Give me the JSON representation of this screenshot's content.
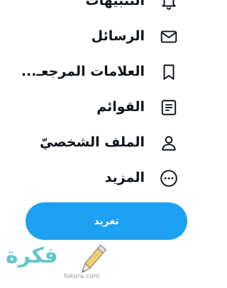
{
  "nav": {
    "items": [
      {
        "label": "التنبيهات",
        "icon": "bell-icon"
      },
      {
        "label": "الرسائل",
        "icon": "envelope-icon"
      },
      {
        "label": "العلامات المرجعـ...",
        "icon": "bookmark-icon"
      },
      {
        "label": "القوائم",
        "icon": "list-icon"
      },
      {
        "label": "الملف الشخصيّ",
        "icon": "person-icon"
      },
      {
        "label": "المزيد",
        "icon": "more-dots-icon"
      }
    ]
  },
  "tweet_button": {
    "label": "تغريد"
  },
  "watermark": {
    "text": "فكرة",
    "site": "fokora.com",
    "icon": "pencil-icon"
  },
  "colors": {
    "accent": "#1da1f2",
    "text": "#0f1419",
    "watermark": "#4dbcc4"
  }
}
